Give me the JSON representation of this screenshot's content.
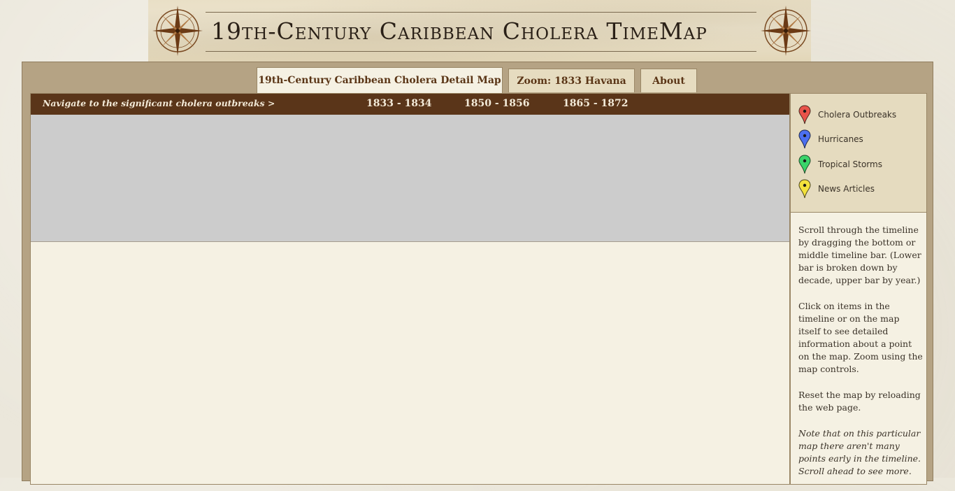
{
  "site": {
    "title": "19th-Century Caribbean Cholera TimeMap"
  },
  "tabs": [
    {
      "label": "19th-Century Caribbean Cholera Detail Map",
      "active": true
    },
    {
      "label": "Zoom: 1833 Havana",
      "active": false
    },
    {
      "label": "About",
      "active": false
    }
  ],
  "nav": {
    "prompt": "Navigate to the significant cholera outbreaks >",
    "links": [
      "1833 - 1834",
      "1850 - 1856",
      "1865 - 1872"
    ]
  },
  "legend": [
    {
      "label": "Cholera Outbreaks",
      "color": "#e8534a",
      "icon": "red-pin-icon"
    },
    {
      "label": "Hurricanes",
      "color": "#4c6ff0",
      "icon": "blue-pin-icon"
    },
    {
      "label": "Tropical Storms",
      "color": "#3bd46a",
      "icon": "green-pin-icon"
    },
    {
      "label": "News Articles",
      "color": "#f3e23c",
      "icon": "yellow-pin-icon"
    }
  ],
  "help": {
    "p1": "Scroll through the timeline by dragging the bottom or middle timeline bar. (Lower bar is broken down by decade, upper bar by year.)",
    "p2": "Click on items in the timeline or on the map itself to see detailed information about a point on the map. Zoom using the map controls.",
    "p3": "Reset the map by reloading the web page.",
    "note": "Note that on this particular map there aren't many points early in the timeline. Scroll ahead to see more."
  },
  "colors": {
    "frame": "#b5a384",
    "nav_bar": "#5a3519",
    "map_placeholder": "#cccccc",
    "panel": "#f5f1e3",
    "tab_text": "#5a3516"
  }
}
